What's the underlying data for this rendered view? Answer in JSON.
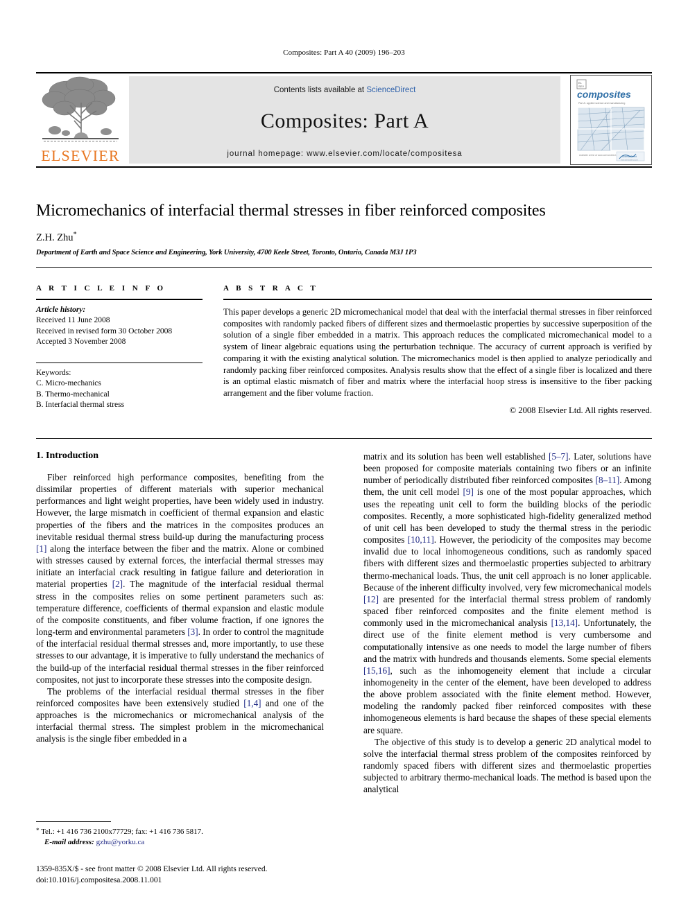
{
  "running_head": "Composites: Part A 40 (2009) 196–203",
  "masthead": {
    "publisher_name": "ELSEVIER",
    "contents_prefix": "Contents lists available at ",
    "contents_link": "ScienceDirect",
    "journal_title": "Composites: Part A",
    "homepage_line": "journal homepage: www.elsevier.com/locate/compositesa",
    "cover": {
      "title": "composites",
      "subtitle": "Part A: applied science and manufacturing",
      "badge": "ScienceDirect",
      "badge_sub": "www.sciencedirect.com"
    },
    "link_color": "#2b5faa",
    "brand_color": "#E87722"
  },
  "article": {
    "title": "Micromechanics of interfacial thermal stresses in fiber reinforced composites",
    "author": "Z.H. Zhu",
    "author_marker": "*",
    "affiliation": "Department of Earth and Space Science and Engineering, York University, 4700 Keele Street, Toronto, Ontario, Canada M3J 1P3"
  },
  "article_info": {
    "heading": "A R T I C L E   I N F O",
    "history_label": "Article history:",
    "history": [
      "Received 11 June 2008",
      "Received in revised form 30 October 2008",
      "Accepted 3 November 2008"
    ],
    "keywords_label": "Keywords:",
    "keywords": [
      "C. Micro-mechanics",
      "B. Thermo-mechanical",
      "B. Interfacial thermal stress"
    ]
  },
  "abstract": {
    "heading": "A B S T R A C T",
    "text": "This paper develops a generic 2D micromechanical model that deal with the interfacial thermal stresses in fiber reinforced composites with randomly packed fibers of different sizes and thermoelastic properties by successive superposition of the solution of a single fiber embedded in a matrix. This approach reduces the complicated micromechanical model to a system of linear algebraic equations using the perturbation technique. The accuracy of current approach is verified by comparing it with the existing analytical solution. The micromechanics model is then applied to analyze periodically and randomly packing fiber reinforced composites. Analysis results show that the effect of a single fiber is localized and there is an optimal elastic mismatch of fiber and matrix where the interfacial hoop stress is insensitive to the fiber packing arrangement and the fiber volume fraction.",
    "copyright": "© 2008 Elsevier Ltd. All rights reserved."
  },
  "body": {
    "section1_heading": "1. Introduction",
    "left_paragraphs": [
      "Fiber reinforced high performance composites, benefiting from the dissimilar properties of different materials with superior mechanical performances and light weight properties, have been widely used in industry. However, the large mismatch in coefficient of thermal expansion and elastic properties of the fibers and the matrices in the composites produces an inevitable residual thermal stress build-up during the manufacturing process [1] along the interface between the fiber and the matrix. Alone or combined with stresses caused by external forces, the interfacial thermal stresses may initiate an interfacial crack resulting in fatigue failure and deterioration in material properties [2]. The magnitude of the interfacial residual thermal stress in the composites relies on some pertinent parameters such as: temperature difference, coefficients of thermal expansion and elastic module of the composite constituents, and fiber volume fraction, if one ignores the long-term and environmental parameters [3]. In order to control the magnitude of the interfacial residual thermal stresses and, more importantly, to use these stresses to our advantage, it is imperative to fully understand the mechanics of the build-up of the interfacial residual thermal stresses in the fiber reinforced composites, not just to incorporate these stresses into the composite design.",
      "The problems of the interfacial residual thermal stresses in the fiber reinforced composites have been extensively studied [1,4] and one of the approaches is the micromechanics or micromechanical analysis of the interfacial thermal stress. The simplest problem in the micromechanical analysis is the single fiber embedded in a"
    ],
    "right_paragraphs": [
      "matrix and its solution has been well established [5–7]. Later, solutions have been proposed for composite materials containing two fibers or an infinite number of periodically distributed fiber reinforced composites [8–11]. Among them, the unit cell model [9] is one of the most popular approaches, which uses the repeating unit cell to form the building blocks of the periodic composites. Recently, a more sophisticated high-fidelity generalized method of unit cell has been developed to study the thermal stress in the periodic composites [10,11]. However, the periodicity of the composites may become invalid due to local inhomogeneous conditions, such as randomly spaced fibers with different sizes and thermoelastic properties subjected to arbitrary thermo-mechanical loads. Thus, the unit cell approach is no loner applicable. Because of the inherent difficulty involved, very few micromechanical models [12] are presented for the interfacial thermal stress problem of randomly spaced fiber reinforced composites and the finite element method is commonly used in the micromechanical analysis [13,14]. Unfortunately, the direct use of the finite element method is very cumbersome and computationally intensive as one needs to model the large number of fibers and the matrix with hundreds and thousands elements. Some special elements [15,16], such as the inhomogeneity element that include a circular inhomogeneity in the center of the element, have been developed to address the above problem associated with the finite element method. However, modeling the randomly packed fiber reinforced composites with these inhomogeneous elements is hard because the shapes of these special elements are square.",
      "The objective of this study is to develop a generic 2D analytical model to solve the interfacial thermal stress problem of the composites reinforced by randomly spaced fibers with different sizes and thermoelastic properties subjected to arbitrary thermo-mechanical loads. The method is based upon the analytical"
    ]
  },
  "footnote": {
    "marker": "*",
    "contact": "Tel.: +1 416 736 2100x77729; fax: +1 416 736 5817.",
    "email_label": "E-mail address:",
    "email": "gzhu@yorku.ca"
  },
  "imprint": {
    "line1": "1359-835X/$ - see front matter © 2008 Elsevier Ltd. All rights reserved.",
    "line2": "doi:10.1016/j.compositesa.2008.11.001"
  }
}
